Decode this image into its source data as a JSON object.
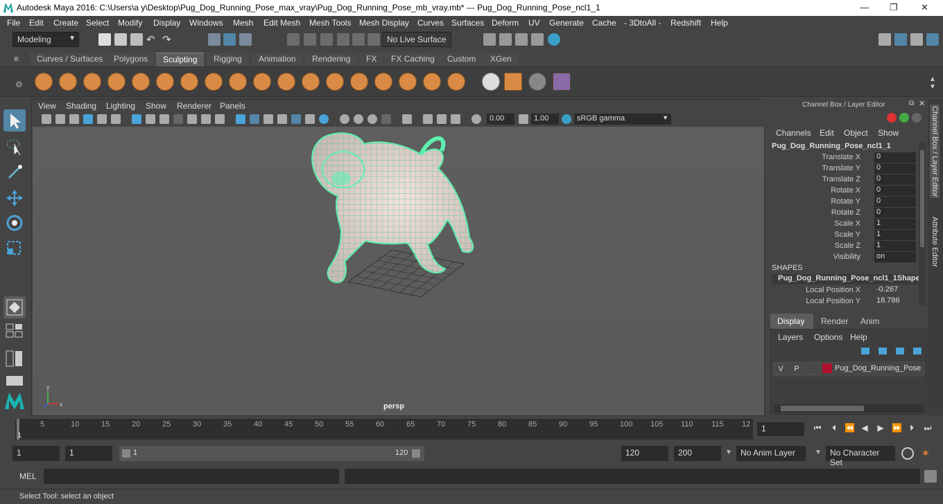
{
  "window": {
    "title": "Autodesk Maya 2016: C:\\Users\\a y\\Desktop\\Pug_Dog_Running_Pose_max_vray\\Pug_Dog_Running_Pose_mb_vray.mb*   ---   Pug_Dog_Running_Pose_ncl1_1",
    "minimize": "—",
    "maximize": "❐",
    "close": "✕"
  },
  "menubar": {
    "items": [
      "File",
      "Edit",
      "Create",
      "Select",
      "Modify",
      "Display",
      "Windows",
      "Mesh",
      "Edit Mesh",
      "Mesh Tools",
      "Mesh Display",
      "Curves",
      "Surfaces",
      "Deform",
      "UV",
      "Generate",
      "Cache",
      "- 3DtoAll -",
      "Redshift",
      "Help"
    ]
  },
  "statusline": {
    "mode": "Modeling",
    "live_surface": "No Live Surface"
  },
  "shelf": {
    "tabs": [
      "Curves / Surfaces",
      "Polygons",
      "Sculpting",
      "Rigging",
      "Animation",
      "Rendering",
      "FX",
      "FX Caching",
      "Custom",
      "XGen"
    ],
    "active_tab": "Sculpting"
  },
  "viewport": {
    "menu": [
      "View",
      "Shading",
      "Lighting",
      "Show",
      "Renderer",
      "Panels"
    ],
    "exposure": "0.00",
    "gamma": "1.00",
    "color_space": "sRGB gamma",
    "camera_label": "persp",
    "axis_y": "y",
    "axis_x": "x"
  },
  "channel_box": {
    "header": "Channel Box / Layer Editor",
    "menu": [
      "Channels",
      "Edit",
      "Object",
      "Show"
    ],
    "object_name": "Pug_Dog_Running_Pose_ncl1_1",
    "channels": [
      {
        "label": "Translate X",
        "value": "0"
      },
      {
        "label": "Translate Y",
        "value": "0"
      },
      {
        "label": "Translate Z",
        "value": "0"
      },
      {
        "label": "Rotate X",
        "value": "0"
      },
      {
        "label": "Rotate Y",
        "value": "0"
      },
      {
        "label": "Rotate Z",
        "value": "0"
      },
      {
        "label": "Scale X",
        "value": "1"
      },
      {
        "label": "Scale Y",
        "value": "1"
      },
      {
        "label": "Scale Z",
        "value": "1"
      },
      {
        "label": "Visibility",
        "value": "on"
      }
    ],
    "shapes_header": "SHAPES",
    "shape_name": "Pug_Dog_Running_Pose_ncl1_1Shape",
    "shape_channels": [
      {
        "label": "Local Position X",
        "value": "-0.267"
      },
      {
        "label": "Local Position Y",
        "value": "18.786"
      }
    ]
  },
  "layer_editor": {
    "tabs": [
      "Display",
      "Render",
      "Anim"
    ],
    "active_tab": "Display",
    "menu": [
      "Layers",
      "Options",
      "Help"
    ],
    "layer": {
      "v": "V",
      "p": "P",
      "name": "Pug_Dog_Running_Pose",
      "color": "#b0122e"
    }
  },
  "side_tabs": [
    "Channel Box / Layer Editor",
    "Attribute Editor"
  ],
  "timeline": {
    "ticks": [
      "5",
      "10",
      "15",
      "20",
      "25",
      "30",
      "35",
      "40",
      "45",
      "50",
      "55",
      "60",
      "65",
      "70",
      "75",
      "80",
      "85",
      "90",
      "95",
      "100",
      "105",
      "110",
      "115",
      "12"
    ],
    "start_marker": "1",
    "current_frame": "1"
  },
  "range": {
    "start": "1",
    "playback_start": "1",
    "slider_start": "1",
    "slider_end": "120",
    "playback_end": "120",
    "end": "200",
    "anim_layer": "No Anim Layer",
    "character_set": "No Character Set"
  },
  "command_line": {
    "label": "MEL"
  },
  "help_line": {
    "text": "Select Tool: select an object"
  },
  "colors": {
    "mesh": "#5cf0b0",
    "accent": "#5285a6"
  }
}
